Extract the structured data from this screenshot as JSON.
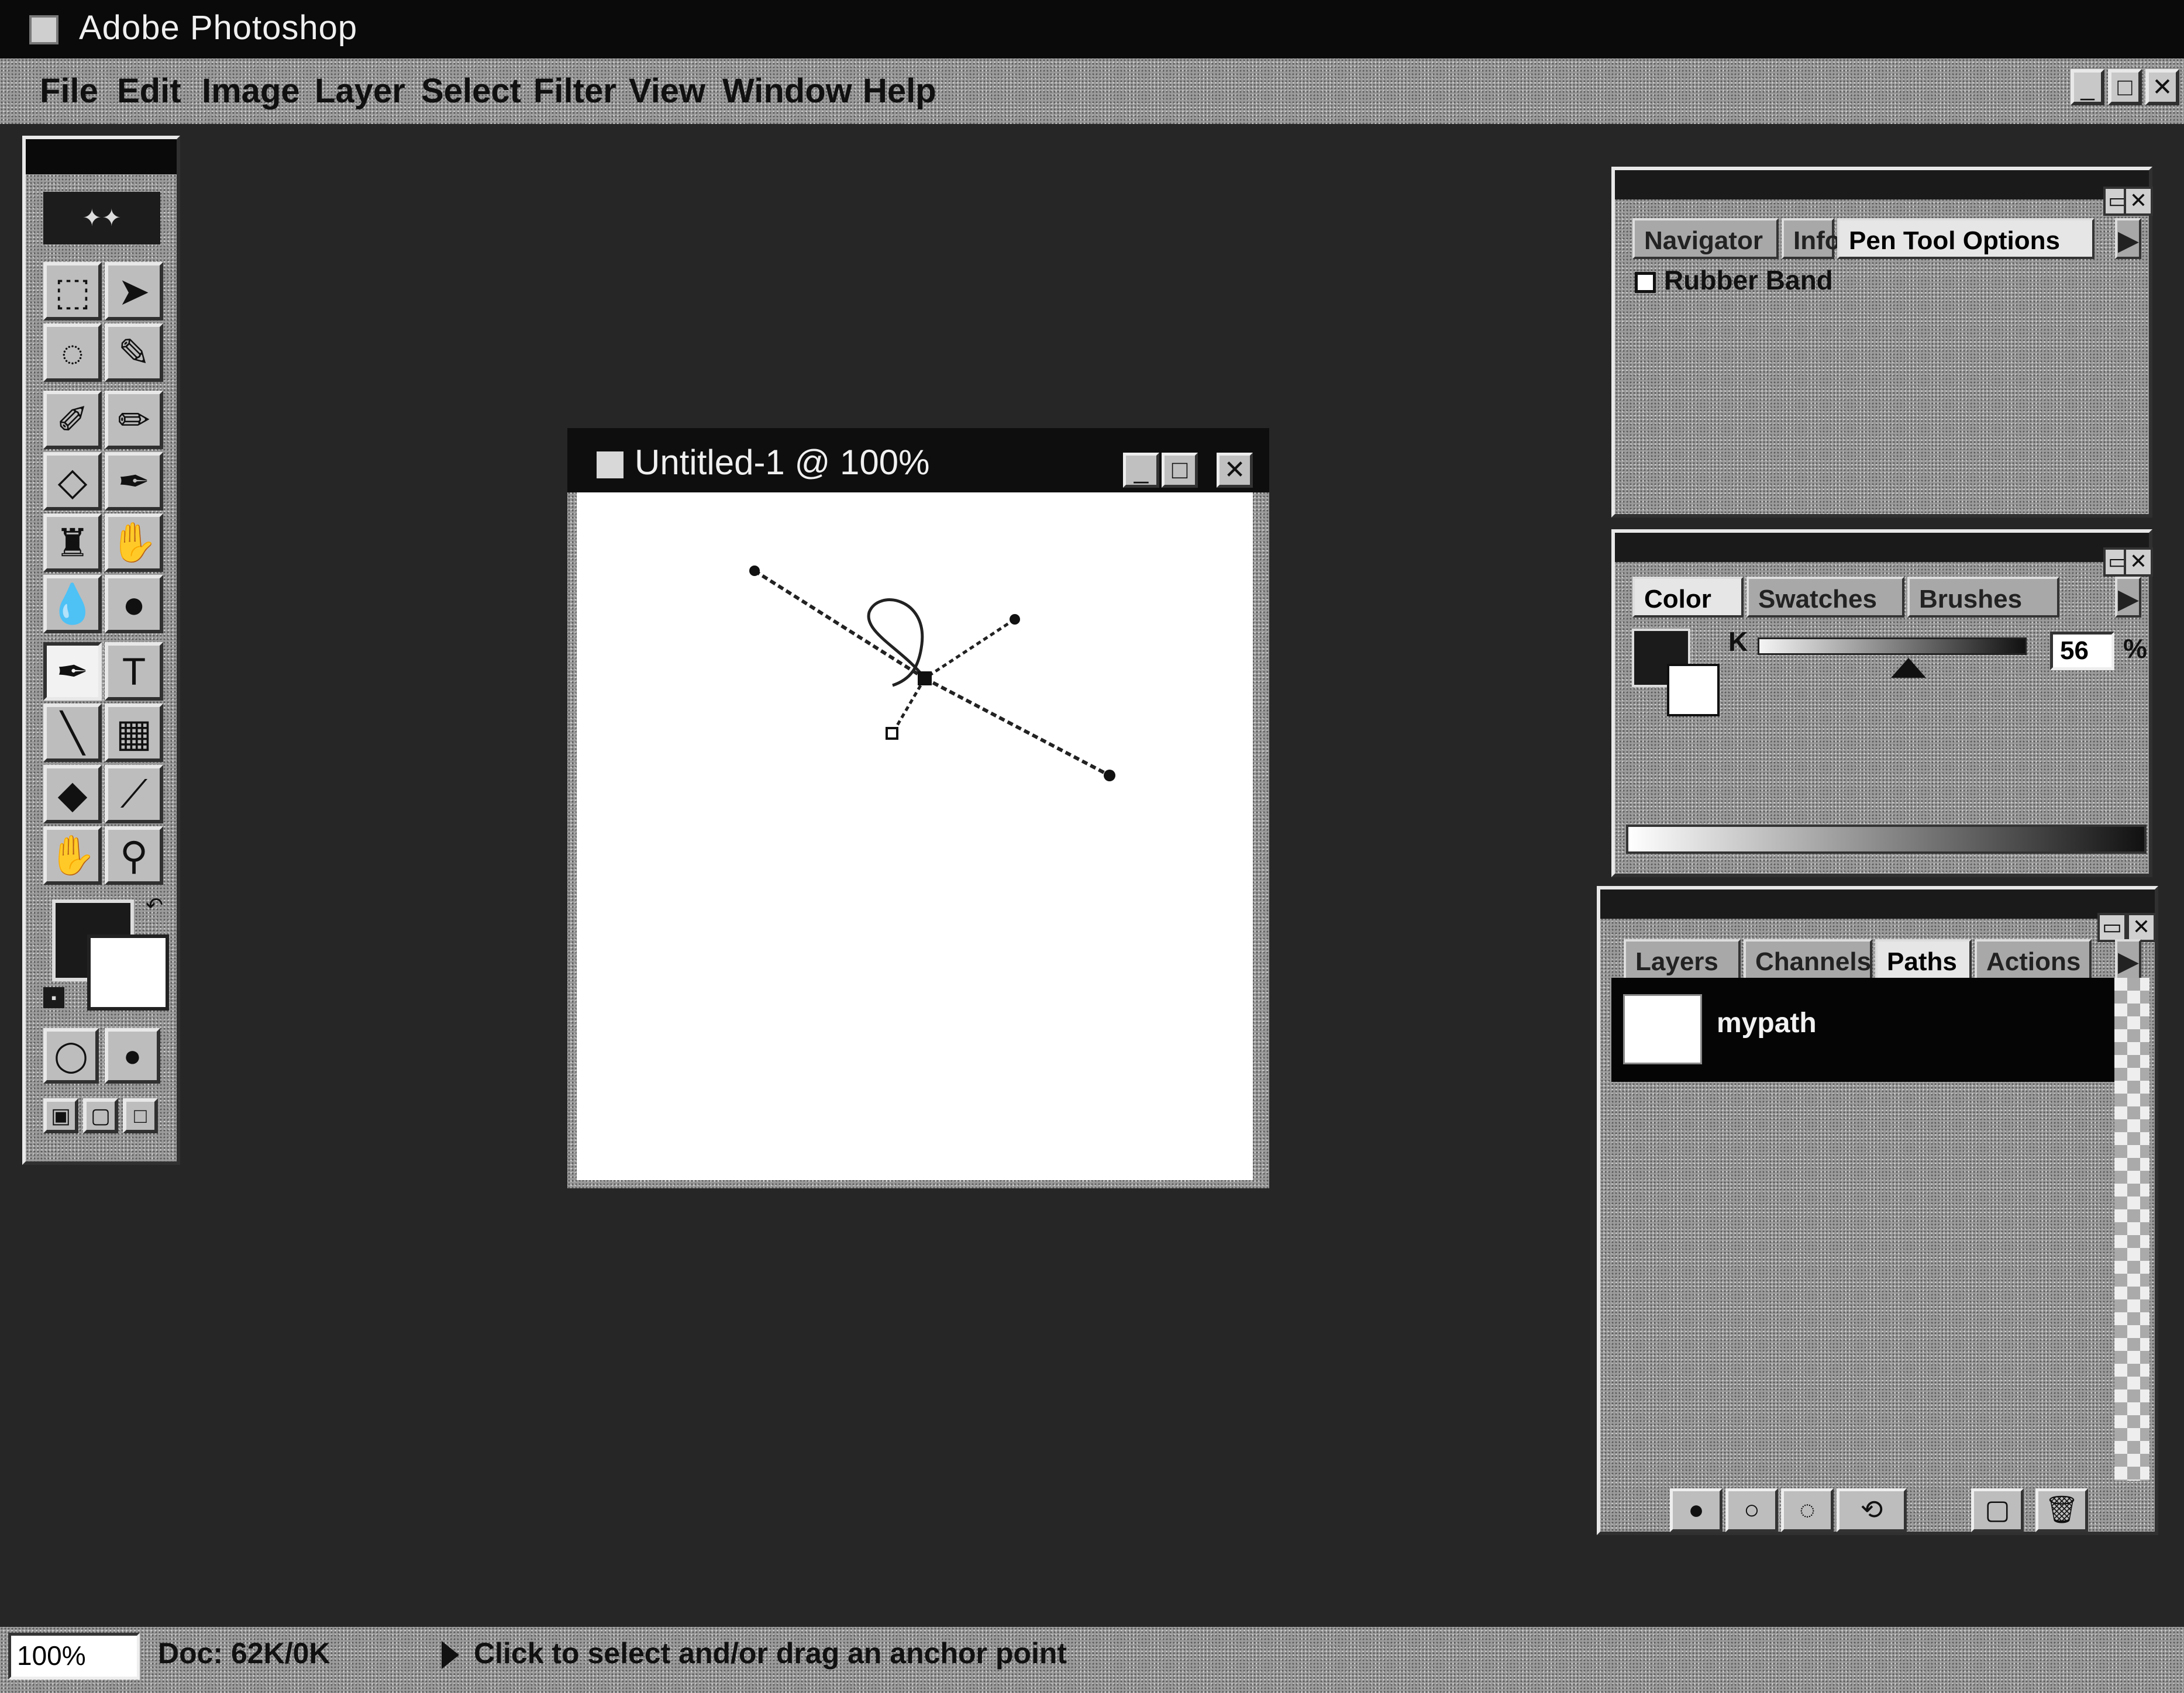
{
  "app": {
    "title": "Adobe Photoshop"
  },
  "menu": {
    "items": [
      {
        "label": "File"
      },
      {
        "label": "Edit"
      },
      {
        "label": "Image"
      },
      {
        "label": "Layer"
      },
      {
        "label": "Select"
      },
      {
        "label": "Filter"
      },
      {
        "label": "View"
      },
      {
        "label": "Window"
      },
      {
        "label": "Help"
      }
    ]
  },
  "window_controls": {
    "minimize": "_",
    "maximize": "□",
    "close": "✕"
  },
  "document": {
    "title": "Untitled-1 @ 100%"
  },
  "toolbox": {
    "tools": [
      {
        "name": "marquee",
        "icon": "⬚"
      },
      {
        "name": "move",
        "icon": "➤"
      },
      {
        "name": "lasso",
        "icon": "◌"
      },
      {
        "name": "magic-wand",
        "icon": "✎"
      },
      {
        "name": "airbrush",
        "icon": "✐"
      },
      {
        "name": "paintbrush",
        "icon": "✏"
      },
      {
        "name": "eraser",
        "icon": "◇"
      },
      {
        "name": "pencil",
        "icon": "✒"
      },
      {
        "name": "rubber-stamp",
        "icon": "♜"
      },
      {
        "name": "smudge",
        "icon": "✋"
      },
      {
        "name": "blur",
        "icon": "💧"
      },
      {
        "name": "dodge",
        "icon": "●"
      },
      {
        "name": "pen",
        "icon": "✒"
      },
      {
        "name": "type",
        "icon": "T"
      },
      {
        "name": "line",
        "icon": "╲"
      },
      {
        "name": "gradient",
        "icon": "▦"
      },
      {
        "name": "paint-bucket",
        "icon": "◆"
      },
      {
        "name": "eyedropper",
        "icon": "⟋"
      },
      {
        "name": "hand",
        "icon": "✋"
      },
      {
        "name": "zoom",
        "icon": "⚲"
      }
    ]
  },
  "palettes": {
    "options": {
      "tabs": [
        {
          "label": "Navigator"
        },
        {
          "label": "Info"
        },
        {
          "label": "Pen Tool Options"
        }
      ],
      "rubber_band_label": "Rubber Band"
    },
    "color": {
      "tabs": [
        {
          "label": "Color"
        },
        {
          "label": "Swatches"
        },
        {
          "label": "Brushes"
        }
      ],
      "channel_label": "K",
      "k_value": "56",
      "percent": "%",
      "k_level_percent": 56,
      "foreground_color": "#1b1b1b",
      "background_color": "#ffffff"
    },
    "layers": {
      "tabs": [
        {
          "label": "Layers"
        },
        {
          "label": "Channels"
        },
        {
          "label": "Paths"
        },
        {
          "label": "Actions"
        }
      ],
      "paths": [
        {
          "name": "mypath"
        }
      ]
    }
  },
  "status": {
    "zoom": "100%",
    "doc_size": "Doc: 62K/0K",
    "hint": "Click to select and/or drag an anchor point"
  }
}
